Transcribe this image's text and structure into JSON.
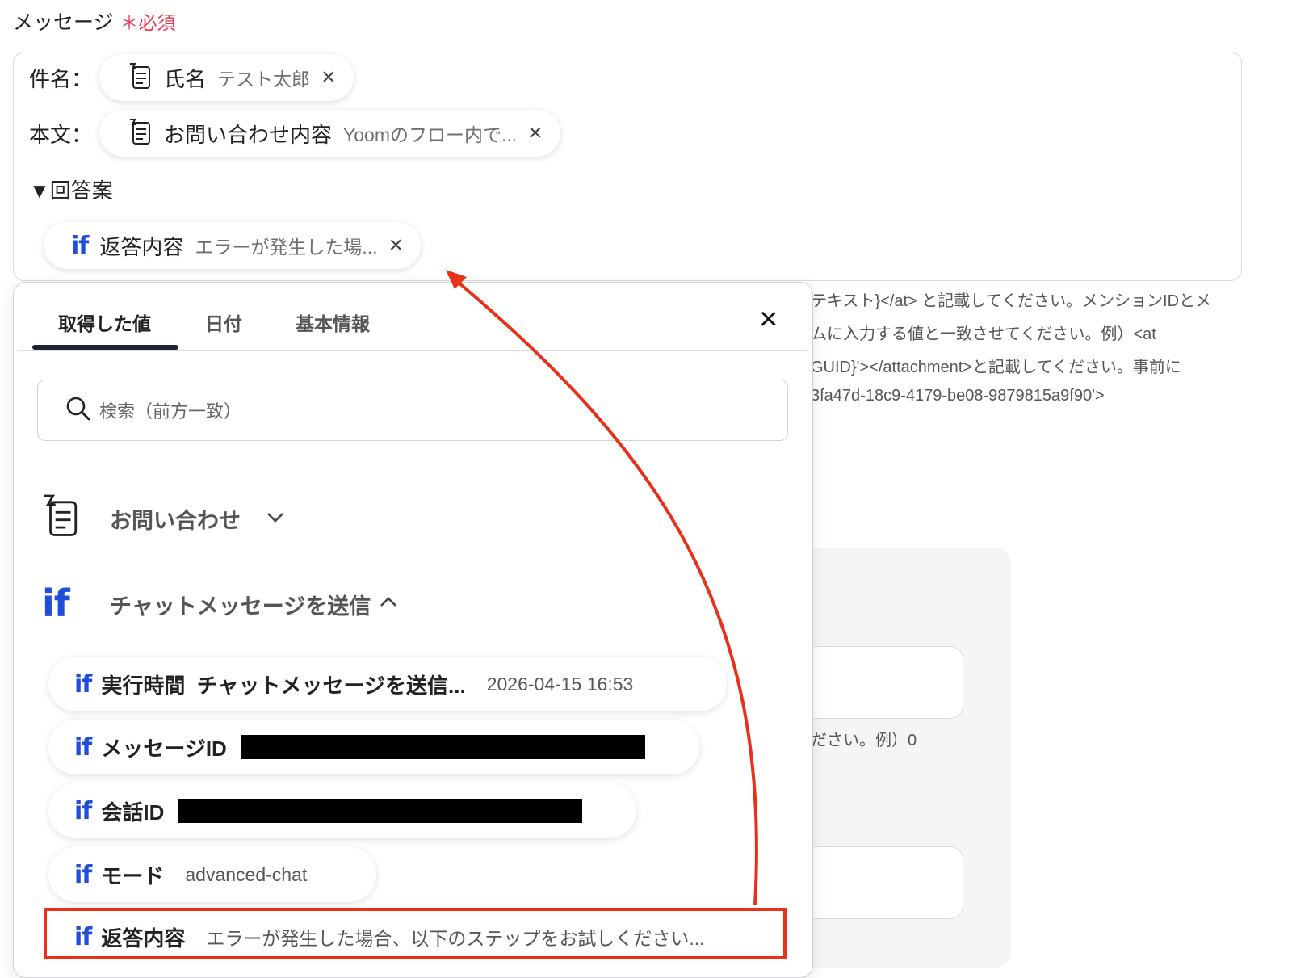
{
  "field": {
    "label": "メッセージ",
    "required_mark": "＊",
    "required_text": "必須"
  },
  "editor": {
    "subject_label": "件名：",
    "subject_token": {
      "name": "氏名",
      "value": "テスト太郎",
      "icon": "form-doc-icon"
    },
    "body_label": "本文：",
    "body_token": {
      "name": "お問い合わせ内容",
      "value": "Yoomのフロー内で...",
      "icon": "form-doc-icon"
    },
    "answer_heading": "▼回答案",
    "answer_token": {
      "name": "返答内容",
      "value": "エラーが発生した場...",
      "icon": "if-icon"
    },
    "remove_icon": "×"
  },
  "background_help": {
    "line1": "テキスト}</at> と記載してください。メンションIDとメ",
    "line2": "ムに入力する値と一致させてください。例）<at",
    "line3": "GUID}'></attachment>と記載してください。事前に",
    "line4": "3fa47d-18c9-4179-be08-9879815a9f90'>",
    "line5": "ださい。例）0"
  },
  "panel": {
    "tabs": [
      "取得した値",
      "日付",
      "基本情報"
    ],
    "active_tab": "取得した値",
    "close": "×",
    "search_placeholder": "検索（前方一致）",
    "groups": [
      {
        "title": "お問い合わせ",
        "icon": "form-doc-icon",
        "expanded": false,
        "chevron": "⌄"
      },
      {
        "title": "チャットメッセージを送信",
        "icon": "if-icon",
        "expanded": true,
        "chevron": "⌃"
      }
    ],
    "items": [
      {
        "name": "実行時間_チャットメッセージを送信...",
        "value": "2026-04-15 16:53",
        "redacted": false
      },
      {
        "name": "メッセージID",
        "value": "",
        "redacted": true
      },
      {
        "name": "会話ID",
        "value": "",
        "redacted": true
      },
      {
        "name": "モード",
        "value": "advanced-chat",
        "redacted": false
      },
      {
        "name": "返答内容",
        "value": "エラーが発生した場合、以下のステップをお試しください...",
        "redacted": false
      }
    ],
    "if_glyph": "if"
  },
  "annotation": {
    "arrow_color": "#e8301b",
    "highlight_color": "#e8301b"
  }
}
